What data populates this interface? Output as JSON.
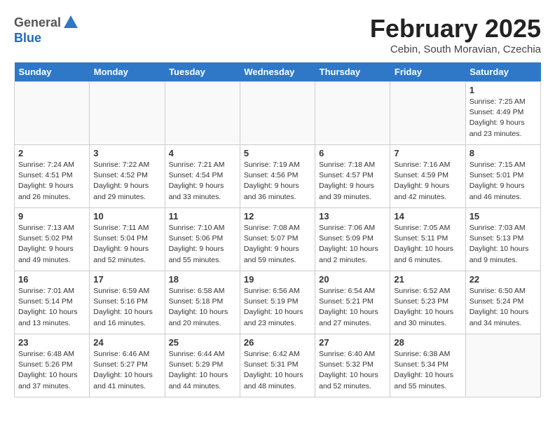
{
  "header": {
    "logo_general": "General",
    "logo_blue": "Blue",
    "month_title": "February 2025",
    "location": "Cebin, South Moravian, Czechia"
  },
  "weekdays": [
    "Sunday",
    "Monday",
    "Tuesday",
    "Wednesday",
    "Thursday",
    "Friday",
    "Saturday"
  ],
  "weeks": [
    [
      {
        "day": "",
        "info": ""
      },
      {
        "day": "",
        "info": ""
      },
      {
        "day": "",
        "info": ""
      },
      {
        "day": "",
        "info": ""
      },
      {
        "day": "",
        "info": ""
      },
      {
        "day": "",
        "info": ""
      },
      {
        "day": "1",
        "info": "Sunrise: 7:25 AM\nSunset: 4:49 PM\nDaylight: 9 hours and 23 minutes."
      }
    ],
    [
      {
        "day": "2",
        "info": "Sunrise: 7:24 AM\nSunset: 4:51 PM\nDaylight: 9 hours and 26 minutes."
      },
      {
        "day": "3",
        "info": "Sunrise: 7:22 AM\nSunset: 4:52 PM\nDaylight: 9 hours and 29 minutes."
      },
      {
        "day": "4",
        "info": "Sunrise: 7:21 AM\nSunset: 4:54 PM\nDaylight: 9 hours and 33 minutes."
      },
      {
        "day": "5",
        "info": "Sunrise: 7:19 AM\nSunset: 4:56 PM\nDaylight: 9 hours and 36 minutes."
      },
      {
        "day": "6",
        "info": "Sunrise: 7:18 AM\nSunset: 4:57 PM\nDaylight: 9 hours and 39 minutes."
      },
      {
        "day": "7",
        "info": "Sunrise: 7:16 AM\nSunset: 4:59 PM\nDaylight: 9 hours and 42 minutes."
      },
      {
        "day": "8",
        "info": "Sunrise: 7:15 AM\nSunset: 5:01 PM\nDaylight: 9 hours and 46 minutes."
      }
    ],
    [
      {
        "day": "9",
        "info": "Sunrise: 7:13 AM\nSunset: 5:02 PM\nDaylight: 9 hours and 49 minutes."
      },
      {
        "day": "10",
        "info": "Sunrise: 7:11 AM\nSunset: 5:04 PM\nDaylight: 9 hours and 52 minutes."
      },
      {
        "day": "11",
        "info": "Sunrise: 7:10 AM\nSunset: 5:06 PM\nDaylight: 9 hours and 55 minutes."
      },
      {
        "day": "12",
        "info": "Sunrise: 7:08 AM\nSunset: 5:07 PM\nDaylight: 9 hours and 59 minutes."
      },
      {
        "day": "13",
        "info": "Sunrise: 7:06 AM\nSunset: 5:09 PM\nDaylight: 10 hours and 2 minutes."
      },
      {
        "day": "14",
        "info": "Sunrise: 7:05 AM\nSunset: 5:11 PM\nDaylight: 10 hours and 6 minutes."
      },
      {
        "day": "15",
        "info": "Sunrise: 7:03 AM\nSunset: 5:13 PM\nDaylight: 10 hours and 9 minutes."
      }
    ],
    [
      {
        "day": "16",
        "info": "Sunrise: 7:01 AM\nSunset: 5:14 PM\nDaylight: 10 hours and 13 minutes."
      },
      {
        "day": "17",
        "info": "Sunrise: 6:59 AM\nSunset: 5:16 PM\nDaylight: 10 hours and 16 minutes."
      },
      {
        "day": "18",
        "info": "Sunrise: 6:58 AM\nSunset: 5:18 PM\nDaylight: 10 hours and 20 minutes."
      },
      {
        "day": "19",
        "info": "Sunrise: 6:56 AM\nSunset: 5:19 PM\nDaylight: 10 hours and 23 minutes."
      },
      {
        "day": "20",
        "info": "Sunrise: 6:54 AM\nSunset: 5:21 PM\nDaylight: 10 hours and 27 minutes."
      },
      {
        "day": "21",
        "info": "Sunrise: 6:52 AM\nSunset: 5:23 PM\nDaylight: 10 hours and 30 minutes."
      },
      {
        "day": "22",
        "info": "Sunrise: 6:50 AM\nSunset: 5:24 PM\nDaylight: 10 hours and 34 minutes."
      }
    ],
    [
      {
        "day": "23",
        "info": "Sunrise: 6:48 AM\nSunset: 5:26 PM\nDaylight: 10 hours and 37 minutes."
      },
      {
        "day": "24",
        "info": "Sunrise: 6:46 AM\nSunset: 5:27 PM\nDaylight: 10 hours and 41 minutes."
      },
      {
        "day": "25",
        "info": "Sunrise: 6:44 AM\nSunset: 5:29 PM\nDaylight: 10 hours and 44 minutes."
      },
      {
        "day": "26",
        "info": "Sunrise: 6:42 AM\nSunset: 5:31 PM\nDaylight: 10 hours and 48 minutes."
      },
      {
        "day": "27",
        "info": "Sunrise: 6:40 AM\nSunset: 5:32 PM\nDaylight: 10 hours and 52 minutes."
      },
      {
        "day": "28",
        "info": "Sunrise: 6:38 AM\nSunset: 5:34 PM\nDaylight: 10 hours and 55 minutes."
      },
      {
        "day": "",
        "info": ""
      }
    ]
  ]
}
